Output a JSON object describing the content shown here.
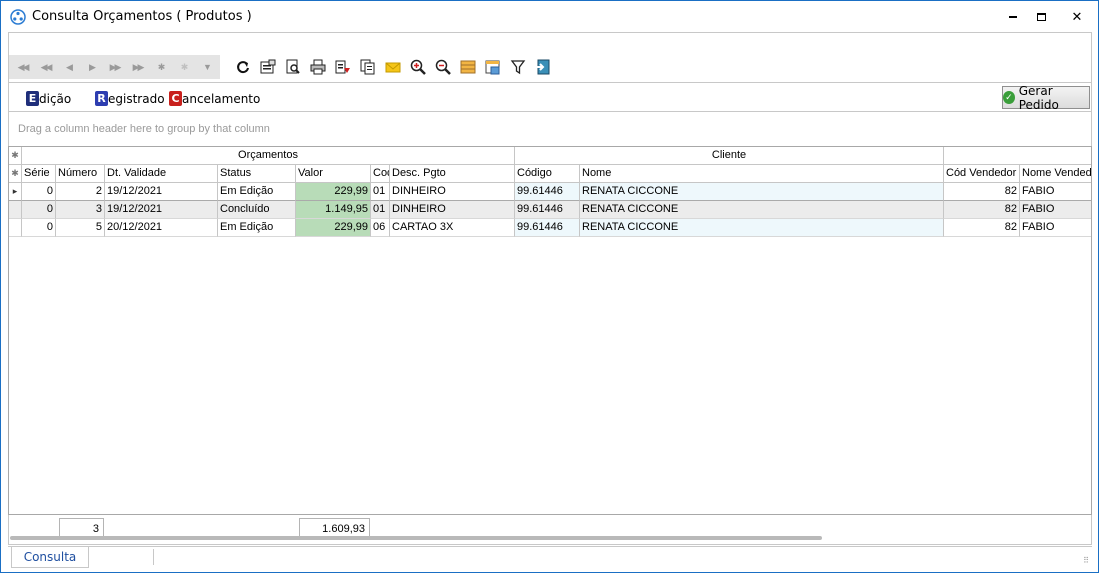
{
  "window": {
    "title": "Consulta Orçamentos ( Produtos )",
    "controls": {
      "minimize": "minimize-icon",
      "maximize": "maximize-icon",
      "close": "✕"
    }
  },
  "navigator": {
    "buttons": [
      {
        "name": "first-icon",
        "glyph": "◀◀"
      },
      {
        "name": "prev-page-icon",
        "glyph": "◀◀"
      },
      {
        "name": "prev-icon",
        "glyph": "◀"
      },
      {
        "name": "next-icon",
        "glyph": "▶"
      },
      {
        "name": "next-page-icon",
        "glyph": "▶▶"
      },
      {
        "name": "last-icon",
        "glyph": "▶▶"
      },
      {
        "name": "insert-icon",
        "glyph": "✱"
      },
      {
        "name": "edit-icon",
        "glyph": "✱"
      },
      {
        "name": "filter-icon",
        "glyph": "▼"
      }
    ]
  },
  "toolbar": {
    "icons": [
      "refresh-icon",
      "properties-icon",
      "preview-icon",
      "print-icon",
      "export-icon",
      "copy-icon",
      "email-icon",
      "zoom-in-icon",
      "zoom-out-icon",
      "grid-icon",
      "window-icon",
      "filter-funnel-icon",
      "exit-icon"
    ]
  },
  "legend": {
    "edicao": {
      "letter": "E",
      "label": "dição",
      "color": "#1f2e7a"
    },
    "registrado": {
      "letter": "R",
      "label": "egistrado",
      "color": "#2d3db0"
    },
    "cancelamento": {
      "letter": "C",
      "label": "ancelamento",
      "color": "#c8201c"
    }
  },
  "gerar_pedido": {
    "label": "Gerar Pedido"
  },
  "group_panel": {
    "hint": "Drag a column header here to group by that column"
  },
  "grid": {
    "bands": {
      "orcamentos": "Orçamentos",
      "cliente": "Cliente",
      "vendedor": ""
    },
    "columns": {
      "serie": "Série",
      "numero": "Número",
      "validade": "Dt. Validade",
      "status": "Status",
      "valor": "Valor",
      "cod": "Cod",
      "desc_pgto": "Desc. Pgto",
      "codigo": "Código",
      "nome": "Nome",
      "cod_vendedor": "Cód Vendedor",
      "nome_vendedor": "Nome Vendedor"
    },
    "rows": [
      {
        "serie": "0",
        "numero": "2",
        "validade": "19/12/2021",
        "status": "Em Edição",
        "valor": "229,99",
        "cod": "01",
        "desc_pgto": "DINHEIRO",
        "codigo": "99.61446",
        "nome": "RENATA CICCONE",
        "cod_vendedor": "82",
        "nome_vendedor": "FABIO"
      },
      {
        "serie": "0",
        "numero": "3",
        "validade": "19/12/2021",
        "status": "Concluído",
        "valor": "1.149,95",
        "cod": "01",
        "desc_pgto": "DINHEIRO",
        "codigo": "99.61446",
        "nome": "RENATA CICCONE",
        "cod_vendedor": "82",
        "nome_vendedor": "FABIO"
      },
      {
        "serie": "0",
        "numero": "5",
        "validade": "20/12/2021",
        "status": "Em Edição",
        "valor": "229,99",
        "cod": "06",
        "desc_pgto": "CARTAO 3X",
        "codigo": "99.61446",
        "nome": "RENATA CICCONE",
        "cod_vendedor": "82",
        "nome_vendedor": "FABIO"
      }
    ]
  },
  "footer": {
    "count": "3",
    "total": "1.609,93"
  },
  "tabs": [
    {
      "label": "Consulta"
    }
  ]
}
